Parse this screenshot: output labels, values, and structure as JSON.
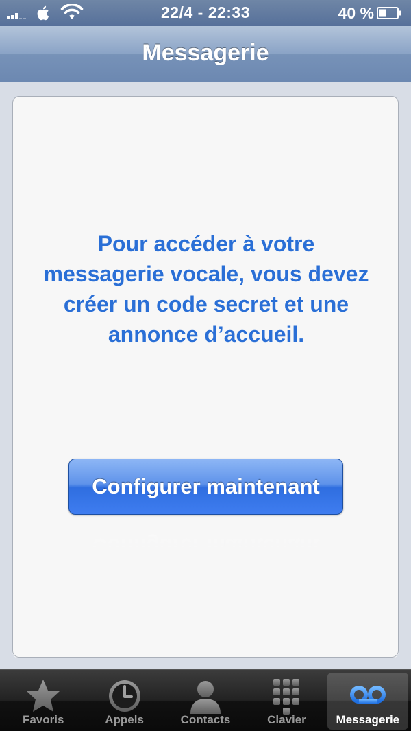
{
  "status_bar": {
    "time": "22/4 - 22:33",
    "battery_percent": "40 %",
    "battery_level": 0.4,
    "signal_bars": 3,
    "icons": [
      "signal-icon",
      "apple-icon",
      "wifi-icon",
      "battery-icon"
    ]
  },
  "nav": {
    "title": "Messagerie"
  },
  "main": {
    "message": "Pour accéder à votre messagerie vocale, vous devez créer un code secret et une annonce d’accueil.",
    "button_label": "Configurer maintenant"
  },
  "tabs": [
    {
      "label": "Favoris",
      "icon": "star-icon",
      "active": false
    },
    {
      "label": "Appels",
      "icon": "clock-icon",
      "active": false
    },
    {
      "label": "Contacts",
      "icon": "contact-icon",
      "active": false
    },
    {
      "label": "Clavier",
      "icon": "keypad-icon",
      "active": false
    },
    {
      "label": "Messagerie",
      "icon": "voicemail-icon",
      "active": true
    }
  ],
  "colors": {
    "accent_text": "#2a6fd6",
    "button": "#3f7df0",
    "nav": "#8aa3c6",
    "active_icon": "#3a8ff0"
  }
}
